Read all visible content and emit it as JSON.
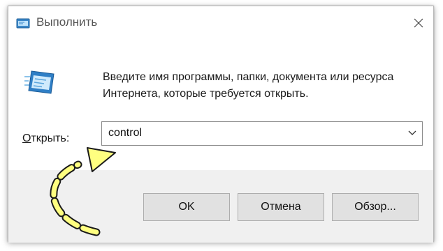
{
  "window": {
    "title": "Выполнить"
  },
  "content": {
    "description": "Введите имя программы, папки, документа или ресурса Интернета, которые требуется открыть.",
    "open_label_accel": "О",
    "open_label_rest": "ткрыть:",
    "command_value": "control"
  },
  "buttons": {
    "ok": "OK",
    "cancel": "Отмена",
    "browse": "Обзор..."
  },
  "annotation": {
    "arrow_color": "#ffff80"
  }
}
